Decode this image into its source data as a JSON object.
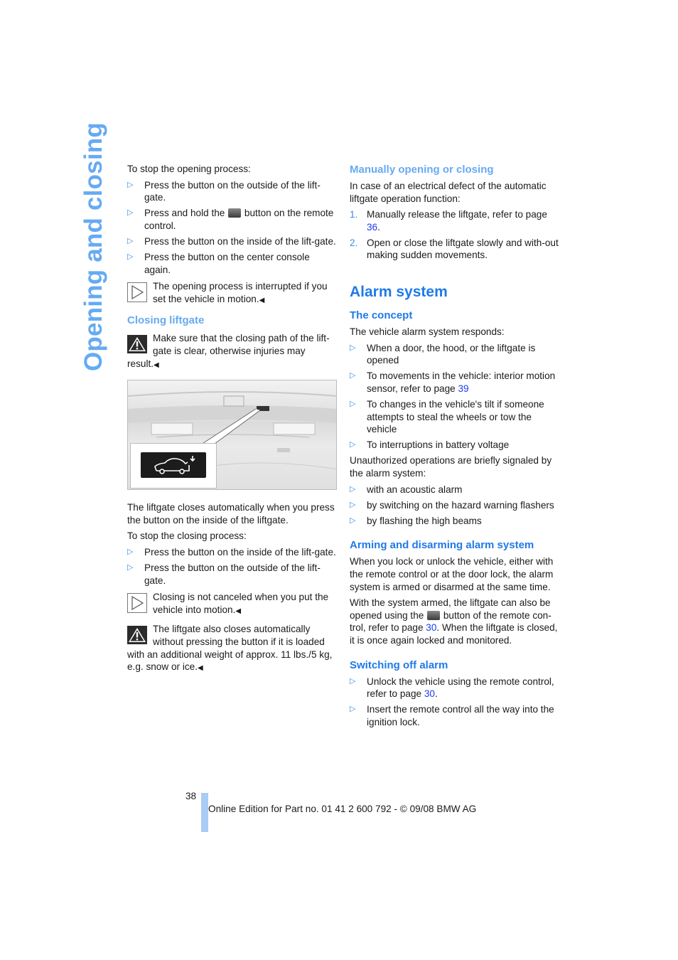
{
  "side_title": "Opening and closing",
  "left": {
    "stop_opening_intro": "To stop the opening process:",
    "stop_opening_items": [
      "Press the button on the outside of the lift-gate.",
      "Press the button on the inside of the lift-gate.",
      "Press the button on the center console again."
    ],
    "remote_item_before": "Press and hold the",
    "remote_item_after": "button on the remote control.",
    "note_opening": "The opening process is interrupted if you set the vehicle in motion.",
    "closing_heading": "Closing liftgate",
    "warning_closing": "Make sure that the closing path of the lift-gate is clear, otherwise injuries may result.",
    "closes_auto": "The liftgate closes automatically when you press the button on the inside of the liftgate.",
    "stop_closing_intro": "To stop the closing process:",
    "stop_closing_items": [
      "Press the button on the inside of the lift-gate.",
      "Press the button on the outside of the lift-gate."
    ],
    "note_closing": "Closing is not canceled when you put the vehicle into motion.",
    "warning_weight": "The liftgate also closes automatically without pressing the button if it is loaded with an additional weight of approx. 11 lbs./5 kg, e.g. snow or ice."
  },
  "right": {
    "manual_heading": "Manually opening or closing",
    "manual_intro": "In case of an electrical defect of the automatic liftgate operation function:",
    "manual_steps": [
      {
        "num": "1.",
        "text": "Manually release the liftgate, refer to page ",
        "link": "36",
        "after": "."
      },
      {
        "num": "2.",
        "text": "Open or close the liftgate slowly and with-out making sudden movements.",
        "link": "",
        "after": ""
      }
    ],
    "alarm_heading": "Alarm system",
    "concept_heading": "The concept",
    "concept_intro": "The vehicle alarm system responds:",
    "concept_items": [
      {
        "text": "When a door, the hood, or the liftgate is opened",
        "link": ""
      },
      {
        "text": "To movements in the vehicle: interior motion sensor, refer to page ",
        "link": "39"
      },
      {
        "text": "To changes in the vehicle's tilt if someone attempts to steal the wheels or tow the vehicle",
        "link": ""
      },
      {
        "text": "To interruptions in battery voltage",
        "link": ""
      }
    ],
    "signal_intro": "Unauthorized operations are briefly signaled by the alarm system:",
    "signal_items": [
      "with an acoustic alarm",
      "by switching on the hazard warning flashers",
      "by flashing the high beams"
    ],
    "arming_heading": "Arming and disarming alarm system",
    "arming_p1": "When you lock or unlock the vehicle, either with the remote control or at the door lock, the alarm system is armed or disarmed at the same time.",
    "arming_p2_before": "With the system armed, the liftgate can also be opened using the",
    "arming_p2_middle": "button of the remote con-trol, refer to page ",
    "arming_p2_link": "30",
    "arming_p2_after": ". When the liftgate is closed, it is once again locked and monitored.",
    "switch_heading": "Switching off alarm",
    "switch_items": [
      {
        "text": "Unlock the vehicle using the remote control, refer to page ",
        "link": "30",
        "after": "."
      },
      {
        "text": "Insert the remote control all the way into the ignition lock.",
        "link": "",
        "after": ""
      }
    ]
  },
  "footer": {
    "page_number": "38",
    "edition": "Online Edition for Part no. 01 41 2 600 792 - © 09/08 BMW AG"
  },
  "glyphs": {
    "bullet": "▷",
    "end": "◀"
  }
}
